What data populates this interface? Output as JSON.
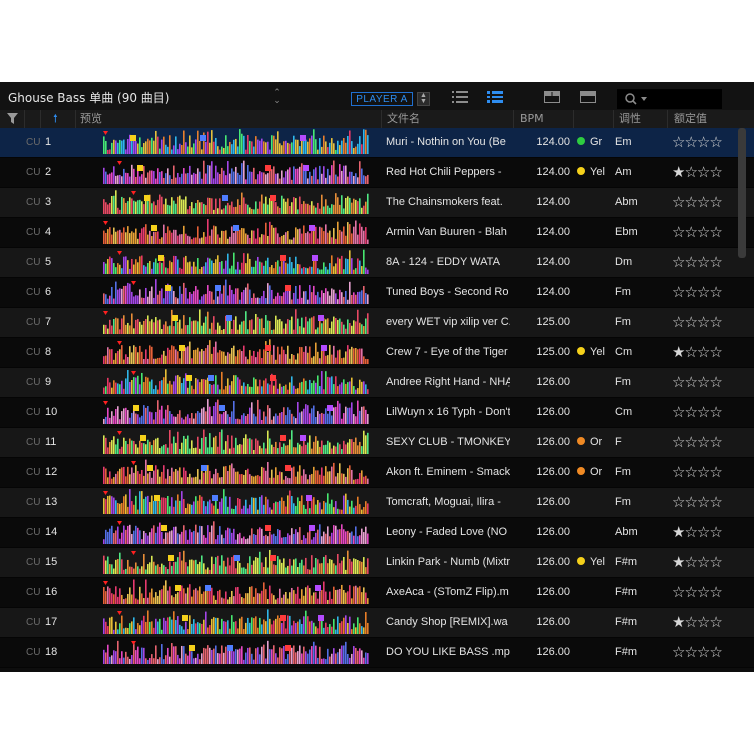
{
  "toolbar": {
    "playlist_title": "Ghouse Bass 单曲 (90 曲目)",
    "player_label": "PLAYER A",
    "search_placeholder": ""
  },
  "columns": {
    "cue": "",
    "num": "",
    "preview": "预览",
    "filename": "文件名",
    "bpm": "BPM",
    "color": "",
    "key": "调性",
    "rating": "额定值"
  },
  "row_cue_label": "CU",
  "colors": {
    "Gr": "#2ecc40",
    "Yel": "#f5d11b",
    "Or": "#f08a24",
    "selected_row": "#0d2447",
    "accent": "#1f6fd0"
  },
  "tracks": [
    {
      "num": "1",
      "name": "Muri - Nothin  on You (Be",
      "bpm": "124.00",
      "color": "Gr",
      "key": "Em",
      "rating": 0,
      "rating_text": "☆☆☆☆",
      "selected": true
    },
    {
      "num": "2",
      "name": "Red Hot Chili Peppers -",
      "bpm": "124.00",
      "color": "Yel",
      "key": "Am",
      "rating": 1,
      "rating_text": "★☆☆☆"
    },
    {
      "num": "3",
      "name": "The Chainsmokers feat.",
      "bpm": "124.00",
      "color": "",
      "key": "Abm",
      "rating": 0,
      "rating_text": "☆☆☆☆"
    },
    {
      "num": "4",
      "name": "Armin Van Buuren - Blah",
      "bpm": "124.00",
      "color": "",
      "key": "Ebm",
      "rating": 0,
      "rating_text": "☆☆☆☆"
    },
    {
      "num": "5",
      "name": "8A - 124 - EDDY WATA",
      "bpm": "124.00",
      "color": "",
      "key": "Dm",
      "rating": 0,
      "rating_text": "☆☆☆☆"
    },
    {
      "num": "6",
      "name": "Tuned Boys - Second Ro",
      "bpm": "124.00",
      "color": "",
      "key": "Fm",
      "rating": 0,
      "rating_text": "☆☆☆☆"
    },
    {
      "num": "7",
      "name": "every WET vip xilip ver C.",
      "bpm": "125.00",
      "color": "",
      "key": "Fm",
      "rating": 0,
      "rating_text": "☆☆☆☆"
    },
    {
      "num": "8",
      "name": "Crew 7 - Eye of the Tiger",
      "bpm": "125.00",
      "color": "Yel",
      "key": "Cm",
      "rating": 1,
      "rating_text": "★☆☆☆"
    },
    {
      "num": "9",
      "name": "Andree Right Hand - NHẠ",
      "bpm": "126.00",
      "color": "",
      "key": "Fm",
      "rating": 0,
      "rating_text": "☆☆☆☆"
    },
    {
      "num": "10",
      "name": "LilWuyn x 16 Typh - Don't",
      "bpm": "126.00",
      "color": "",
      "key": "Cm",
      "rating": 0,
      "rating_text": "☆☆☆☆"
    },
    {
      "num": "11",
      "name": "SEXY CLUB - TMONKEY",
      "bpm": "126.00",
      "color": "Or",
      "key": "F",
      "rating": 0,
      "rating_text": "☆☆☆☆"
    },
    {
      "num": "12",
      "name": "Akon ft. Eminem - Smack",
      "bpm": "126.00",
      "color": "Or",
      "key": "Fm",
      "rating": 0,
      "rating_text": "☆☆☆☆"
    },
    {
      "num": "13",
      "name": "Tomcraft, Moguai, Ilira -",
      "bpm": "126.00",
      "color": "",
      "key": "Fm",
      "rating": 0,
      "rating_text": "☆☆☆☆"
    },
    {
      "num": "14",
      "name": "Leony - Faded Love (NO",
      "bpm": "126.00",
      "color": "",
      "key": "Abm",
      "rating": 1,
      "rating_text": "★☆☆☆"
    },
    {
      "num": "15",
      "name": "Linkin Park - Numb (Mixtr",
      "bpm": "126.00",
      "color": "Yel",
      "key": "F#m",
      "rating": 1,
      "rating_text": "★☆☆☆"
    },
    {
      "num": "16",
      "name": "AxeAca - (STomZ Flip).m",
      "bpm": "126.00",
      "color": "",
      "key": "F#m",
      "rating": 0,
      "rating_text": "☆☆☆☆"
    },
    {
      "num": "17",
      "name": "Candy Shop [REMIX].wa",
      "bpm": "126.00",
      "color": "",
      "key": "F#m",
      "rating": 1,
      "rating_text": "★☆☆☆"
    },
    {
      "num": "18",
      "name": "DO YOU LIKE BASS .mp",
      "bpm": "126.00",
      "color": "",
      "key": "F#m",
      "rating": 0,
      "rating_text": "☆☆☆☆"
    }
  ]
}
